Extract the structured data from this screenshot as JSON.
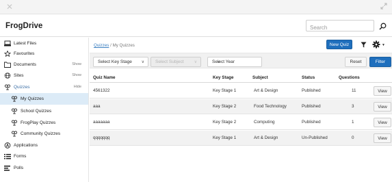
{
  "app": {
    "title": "FrogDrive"
  },
  "search": {
    "placeholder": "Search"
  },
  "sidebar": {
    "items": [
      {
        "label": "Latest Files",
        "icon": "latest-files-icon"
      },
      {
        "label": "Favourites",
        "icon": "star-icon"
      },
      {
        "label": "Documents",
        "icon": "documents-icon",
        "toggle": "Show"
      },
      {
        "label": "Sites",
        "icon": "globe-icon",
        "toggle": "Show"
      },
      {
        "label": "Quizzes",
        "icon": "quiz-icon",
        "toggle": "Hide"
      },
      {
        "label": "My Quizzes",
        "icon": "quiz-icon",
        "active": true
      },
      {
        "label": "School Quizzes",
        "icon": "quiz-icon"
      },
      {
        "label": "FrogPlay Quizzes",
        "icon": "quiz-icon"
      },
      {
        "label": "Community Quizzes",
        "icon": "quiz-icon"
      },
      {
        "label": "Applications",
        "icon": "applications-icon"
      },
      {
        "label": "Forms",
        "icon": "forms-icon"
      },
      {
        "label": "Polls",
        "icon": "polls-icon"
      }
    ]
  },
  "breadcrumb": {
    "root": "Quizzes",
    "separator": "/",
    "current": "My Quizzes"
  },
  "toolbar": {
    "new_quiz": "New Quiz"
  },
  "filters": {
    "key_stage": "Select Key Stage",
    "subject": "Select Subject",
    "year": "Select Year",
    "reset": "Reset",
    "filter": "Filter"
  },
  "table": {
    "headers": [
      "Quiz Name",
      "Key Stage",
      "Subject",
      "Status",
      "Questions"
    ],
    "view_label": "View",
    "rows": [
      {
        "name": "4561322",
        "key_stage": "Key Stage 1",
        "subject": "Art & Design",
        "status": "Published",
        "questions": "11"
      },
      {
        "name": "aaa",
        "key_stage": "Key Stage 2",
        "subject": "Food Technology",
        "status": "Published",
        "questions": "3"
      },
      {
        "name": "aaaaaaa",
        "key_stage": "Key Stage 2",
        "subject": "Computing",
        "status": "Published",
        "questions": "1"
      },
      {
        "name": "qqqqqqq",
        "key_stage": "Key Stage 1",
        "subject": "Art & Design",
        "status": "Un-Published",
        "questions": "0"
      }
    ]
  },
  "colors": {
    "primary": "#1f6fbd",
    "active_bg": "#dcebf7",
    "link": "#3a7fc1"
  }
}
